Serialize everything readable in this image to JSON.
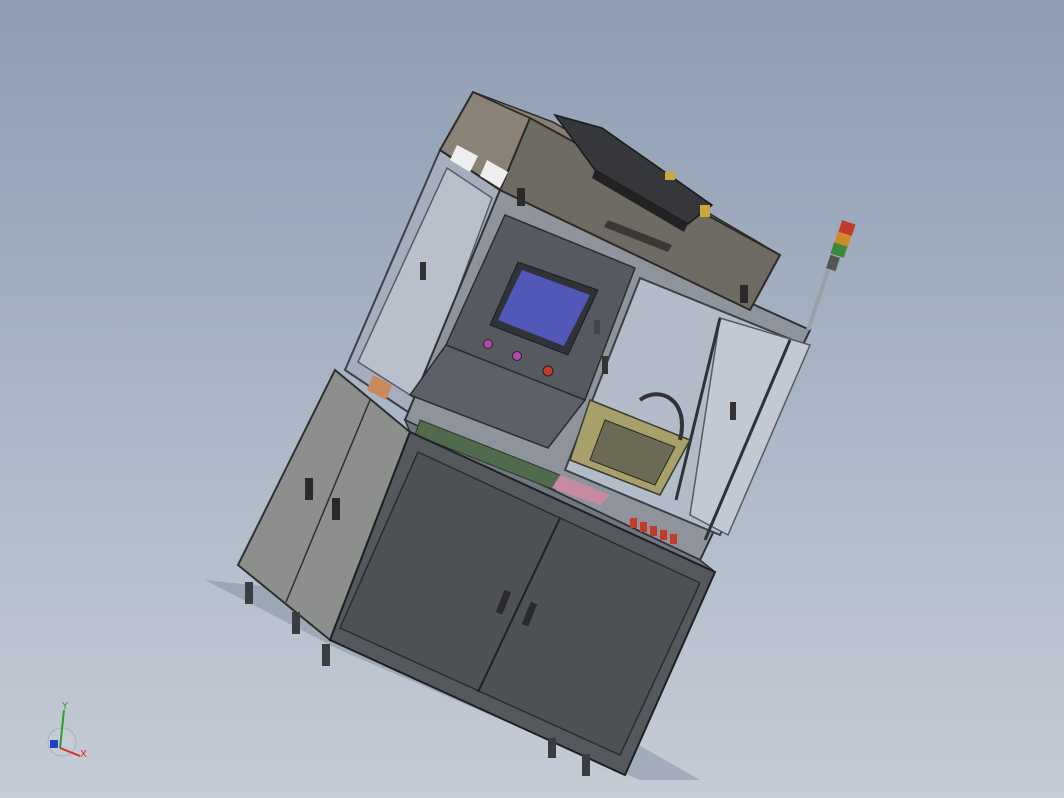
{
  "viewport": {
    "background_top": "#8e9db2",
    "background_bottom": "#c6ccd6"
  },
  "model": {
    "colors": {
      "frame": "#8a8f98",
      "frame_dark": "#4a4e56",
      "cabinet_front": "#55585c",
      "cabinet_side": "#8d8f8c",
      "hood": "#6e6a64",
      "hood_top": "#7b766e",
      "screen": "#5258b8",
      "glass": "#aab2c4",
      "accent_yellow": "#c8a93a",
      "accent_magenta": "#b04aa8",
      "light_red": "#c23a2a",
      "light_orange": "#d08a2a",
      "light_green": "#3a8a3a"
    },
    "signal_tower": [
      "red",
      "orange",
      "green"
    ]
  },
  "triad": {
    "x_label": "X",
    "y_label": "Y",
    "x_color": "#d03030",
    "y_color": "#2aa02a",
    "z_color": "#2040c0"
  }
}
